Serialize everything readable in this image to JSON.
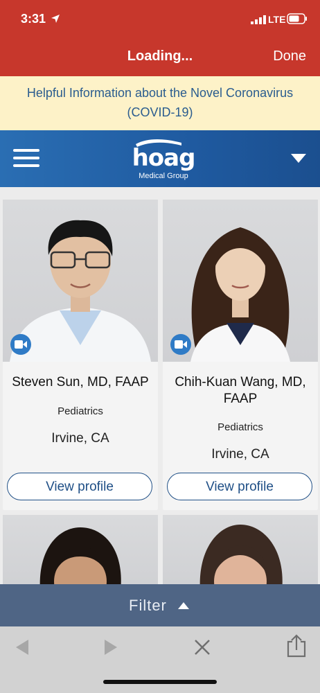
{
  "status": {
    "time": "3:31",
    "network": "LTE"
  },
  "nav": {
    "title": "Loading...",
    "done_label": "Done"
  },
  "banner": {
    "text": "Helpful Information about the Novel Coronavirus (COVID-19)"
  },
  "brand": {
    "logo_text": "hoag",
    "logo_subtitle": "Medical Group"
  },
  "doctors": [
    {
      "name": "Steven Sun, MD, FAAP",
      "specialty": "Pediatrics",
      "location": "Irvine, CA",
      "button": "View profile",
      "video_visit": true
    },
    {
      "name": "Chih-Kuan Wang, MD, FAAP",
      "specialty": "Pediatrics",
      "location": "Irvine, CA",
      "button": "View profile",
      "video_visit": true
    }
  ],
  "filter": {
    "label": "Filter"
  },
  "toolbar": {
    "icons": [
      "back-icon",
      "forward-icon",
      "close-icon",
      "share-icon"
    ]
  },
  "colors": {
    "header_red": "#c7372c",
    "banner_bg": "#fdf2c8",
    "brand_blue": "#1f5aa0",
    "filter_bar": "#4f6585",
    "accent_blue": "#2f7bc6"
  }
}
